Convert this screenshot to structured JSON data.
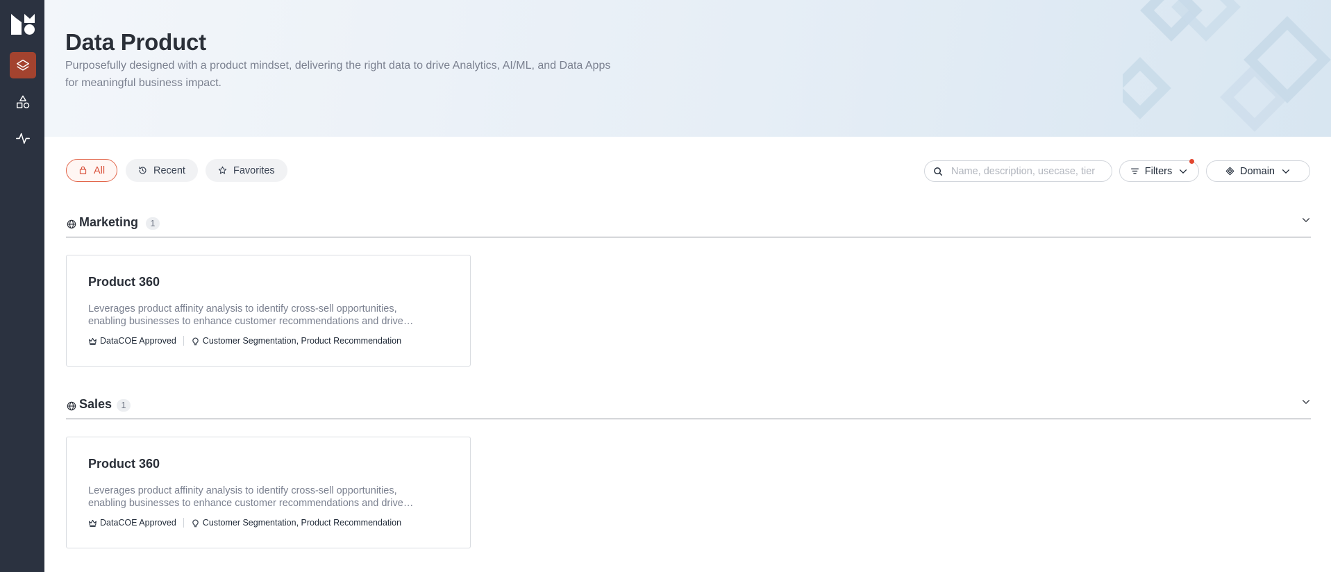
{
  "page": {
    "title": "Data Product",
    "description": "Purposefully designed with a product mindset, delivering the right data to drive Analytics, AI/ML, and Data Apps for meaningful business impact."
  },
  "sidebar": {
    "items": [
      {
        "icon": "layers-icon",
        "active": true
      },
      {
        "icon": "shapes-icon",
        "active": false
      },
      {
        "icon": "activity-icon",
        "active": false
      }
    ]
  },
  "tabs": [
    {
      "label": "All",
      "icon": "bag-icon",
      "active": true
    },
    {
      "label": "Recent",
      "icon": "history-icon",
      "active": false
    },
    {
      "label": "Favorites",
      "icon": "star-icon",
      "active": false
    }
  ],
  "search": {
    "placeholder": "Name, description, usecase, tier"
  },
  "filters": {
    "label": "Filters"
  },
  "domain": {
    "label": "Domain"
  },
  "sections": [
    {
      "title": "Marketing",
      "count": "1",
      "cards": [
        {
          "title": "Product 360",
          "description": "Leverages product affinity analysis to identify cross-sell opportunities, enabling businesses to enhance customer recommendations and drive targeted marketing strategies.",
          "tier": "DataCOE Approved",
          "usecases": "Customer Segmentation, Product Recommendation"
        }
      ]
    },
    {
      "title": "Sales",
      "count": "1",
      "cards": [
        {
          "title": "Product 360",
          "description": "Leverages product affinity analysis to identify cross-sell opportunities, enabling businesses to enhance customer recommendations and drive targeted marketing strategies.",
          "tier": "DataCOE Approved",
          "usecases": "Customer Segmentation, Product Recommendation"
        }
      ]
    }
  ],
  "colors": {
    "sidebar_bg": "#2b3240",
    "sidebar_active": "#a3432f",
    "accent": "#e2664b",
    "notification_dot": "#e2472f"
  }
}
